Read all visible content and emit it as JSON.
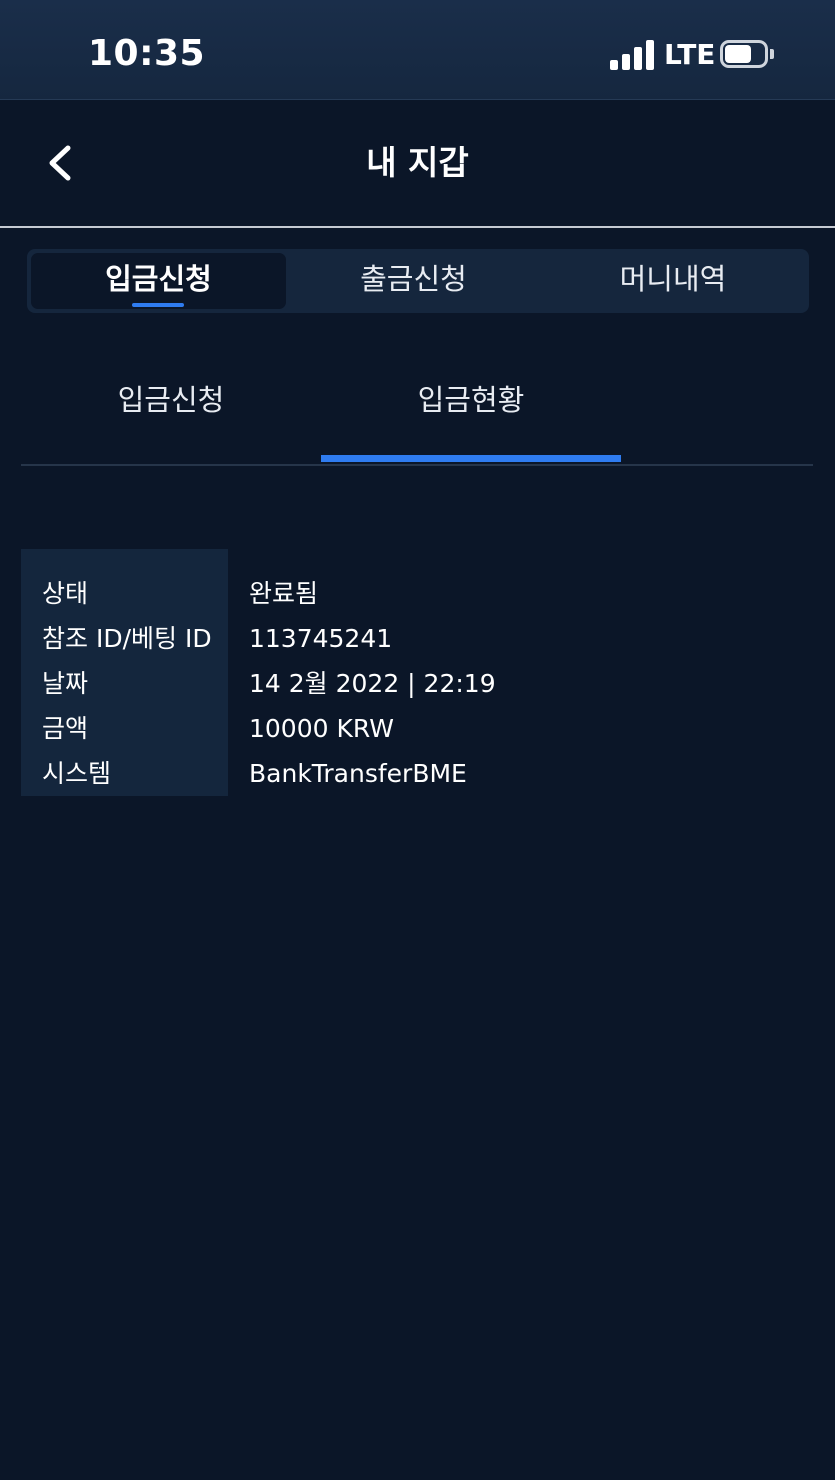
{
  "status_bar": {
    "time": "10:35",
    "network": "LTE"
  },
  "header": {
    "title": "내 지갑",
    "back_icon": "chevron-left-icon"
  },
  "segment_tabs": [
    {
      "label": "입금신청",
      "active": true
    },
    {
      "label": "출금신청",
      "active": false
    },
    {
      "label": "머니내역",
      "active": false
    }
  ],
  "sub_tabs": [
    {
      "label": "입금신청",
      "active": false
    },
    {
      "label": "입금현황",
      "active": true
    }
  ],
  "details": [
    {
      "label": "상태",
      "value": "완료됨"
    },
    {
      "label": "참조 ID/베팅 ID",
      "value": "113745241"
    },
    {
      "label": "날짜",
      "value": "14 2월 2022 | 22:19"
    },
    {
      "label": "금액",
      "value": "10000 KRW"
    },
    {
      "label": "시스템",
      "value": "BankTransferBME"
    }
  ],
  "colors": {
    "background": "#0b1628",
    "accent": "#2f7cf0",
    "panel": "#15263d"
  }
}
